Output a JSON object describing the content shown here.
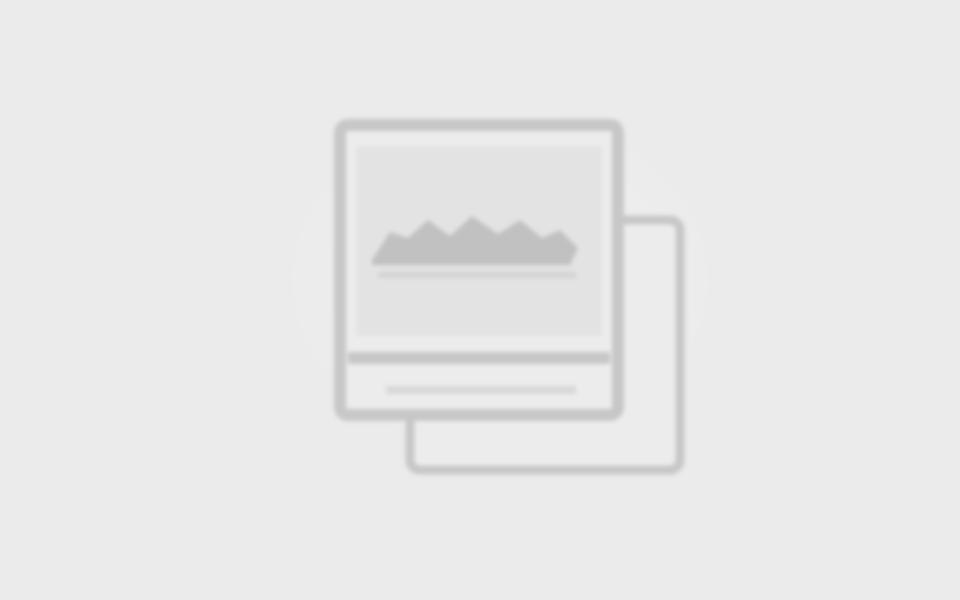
{
  "screen": {
    "kind": "image-placeholder",
    "background_color": "#ebebeb",
    "icon": {
      "name": "image-gallery-placeholder-icon",
      "stroke_color": "#c7c7c7",
      "fill_color": "#ececec",
      "mountain_color": "#bcbcbc",
      "sky_color": "#e3e3e3"
    }
  }
}
